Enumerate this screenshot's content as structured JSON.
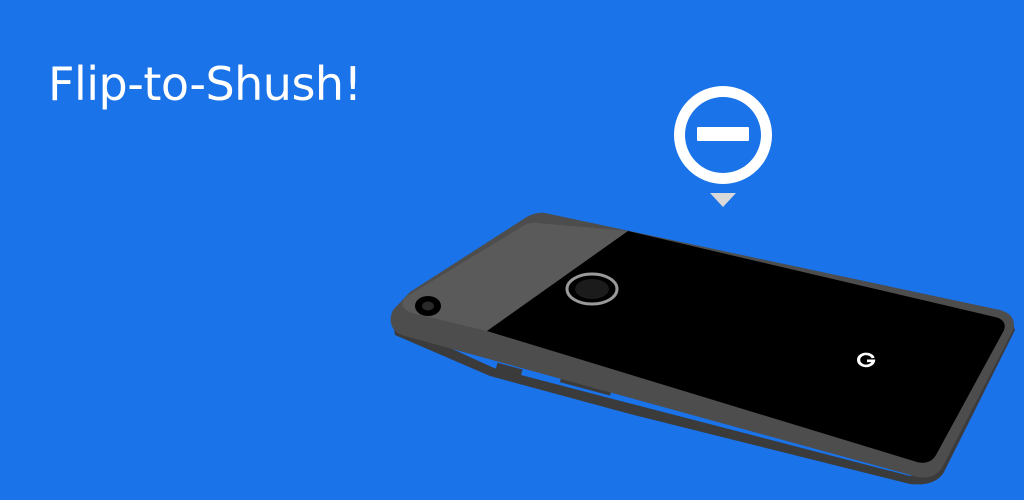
{
  "banner": {
    "title": "Flip-to-Shush!"
  },
  "colors": {
    "background": "#1a73e8",
    "text": "#ffffff",
    "phone_frame": "#4d4d4d",
    "phone_frame_side": "#3b3b3b",
    "phone_back": "#000000",
    "camera_glass": "#5a5a5a",
    "badge": "#ffffff",
    "pointer": "#d9d9d9"
  },
  "icons": {
    "dnd_badge": "do-not-disturb-icon",
    "logo": "google-g-logo"
  }
}
